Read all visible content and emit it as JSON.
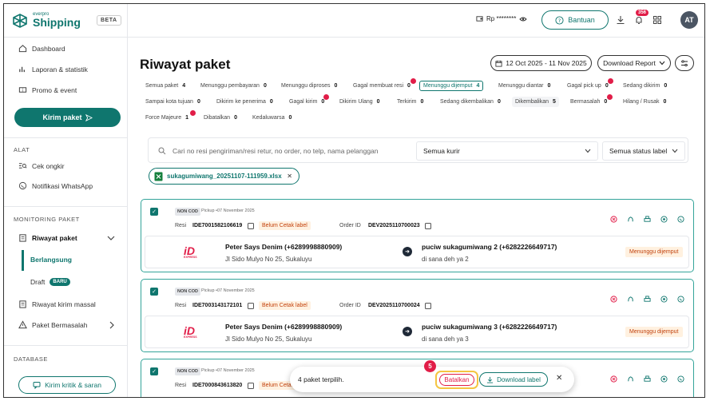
{
  "brand": {
    "top": "everpro",
    "name": "Shipping",
    "beta": "BETA"
  },
  "sidebar": {
    "dashboard": "Dashboard",
    "laporan": "Laporan & statistik",
    "promo": "Promo & event",
    "kirim": "Kirim paket",
    "alat_head": "ALAT",
    "cek": "Cek ongkir",
    "notif": "Notifikasi WhatsApp",
    "monitor_head": "MONITORING PAKET",
    "riwayat": "Riwayat paket",
    "berlangsung": "Berlangsung",
    "draft": "Draft",
    "baru": "BARU",
    "massal": "Riwayat kirim massal",
    "bermasalah": "Paket Bermasalah",
    "db_head": "DATABASE",
    "kritik": "Kirim kritik & saran"
  },
  "topbar": {
    "rp": "Rp ********",
    "bantuan": "Bantuan",
    "notif_count": "356",
    "avatar": "AT"
  },
  "page": {
    "title": "Riwayat paket",
    "date_range": "12 Oct 2025 - 11 Nov 2025",
    "download": "Download Report"
  },
  "chips": [
    {
      "label": "Semua paket",
      "count": "4"
    },
    {
      "label": "Menunggu pembayaran",
      "count": "0"
    },
    {
      "label": "Menunggu diproses",
      "count": "0"
    },
    {
      "label": "Gagal membuat resi",
      "count": "0"
    },
    {
      "label": "Menunggu dijemput",
      "count": "4"
    },
    {
      "label": "Menunggu diantar",
      "count": "0"
    },
    {
      "label": "Gagal pick up",
      "count": "0"
    },
    {
      "label": "Sedang dikirim",
      "count": "0"
    },
    {
      "label": "Sampai kota tujuan",
      "count": "0"
    },
    {
      "label": "Dikirim ke penerima",
      "count": "0"
    },
    {
      "label": "Gagal kirim",
      "count": "0"
    },
    {
      "label": "Dikirim Ulang",
      "count": "0"
    },
    {
      "label": "Terkirim",
      "count": "0"
    },
    {
      "label": "Sedang dikembalikan",
      "count": "0"
    },
    {
      "label": "Dikembalikan",
      "count": "5"
    },
    {
      "label": "Bermasalah",
      "count": "0"
    },
    {
      "label": "Hilang / Rusak",
      "count": "0"
    },
    {
      "label": "Force Majeure",
      "count": "1"
    },
    {
      "label": "Dibatalkan",
      "count": "0"
    },
    {
      "label": "Kedaluwarsa",
      "count": "0"
    }
  ],
  "search": {
    "placeholder": "Cari no resi pengiriman/resi retur, no order, no telp, nama pelanggan",
    "kurir": "Semua kurir",
    "status": "Semua status label"
  },
  "file": "sukagumiwang_20251107-111959.xlsx",
  "cards": [
    {
      "noncod": "NON COD",
      "pickup": "Pickup •07 November 2025",
      "resi_label": "Resi",
      "resi": "IDE7001582106619",
      "cetak": "Belum Cetak label",
      "order_label": "Order ID",
      "order": "DEV2025110700023",
      "sender": "Peter Says Denim (+6289998880909)",
      "sender_addr": "Jl Sido Mulyo No 25, Sukaluyu",
      "receiver": "puciw sukagumiwang 2 (+6282226649717)",
      "receiver_addr": "di sana deh ya 2",
      "status": "Menunggu dijemput"
    },
    {
      "noncod": "NON COD",
      "pickup": "Pickup •07 November 2025",
      "resi_label": "Resi",
      "resi": "IDE7003143172101",
      "cetak": "Belum Cetak label",
      "order_label": "Order ID",
      "order": "DEV2025110700024",
      "sender": "Peter Says Denim (+6289998880909)",
      "sender_addr": "Jl Sido Mulyo No 25, Sukaluyu",
      "receiver": "puciw sukagumiwang 3 (+6282226649717)",
      "receiver_addr": "di sana deh ya 3",
      "status": "Menunggu dijemput"
    },
    {
      "noncod": "NON COD",
      "pickup": "Pickup •07 November 2025",
      "resi_label": "Resi",
      "resi": "IDE7000843613820",
      "cetak": "Belum Cetak"
    }
  ],
  "courier": {
    "logo": "iD",
    "sub": "EXPRESS"
  },
  "bulk": {
    "text": "4 paket terpilih.",
    "batal": "Batalkan",
    "download": "Download label",
    "step": "5"
  }
}
